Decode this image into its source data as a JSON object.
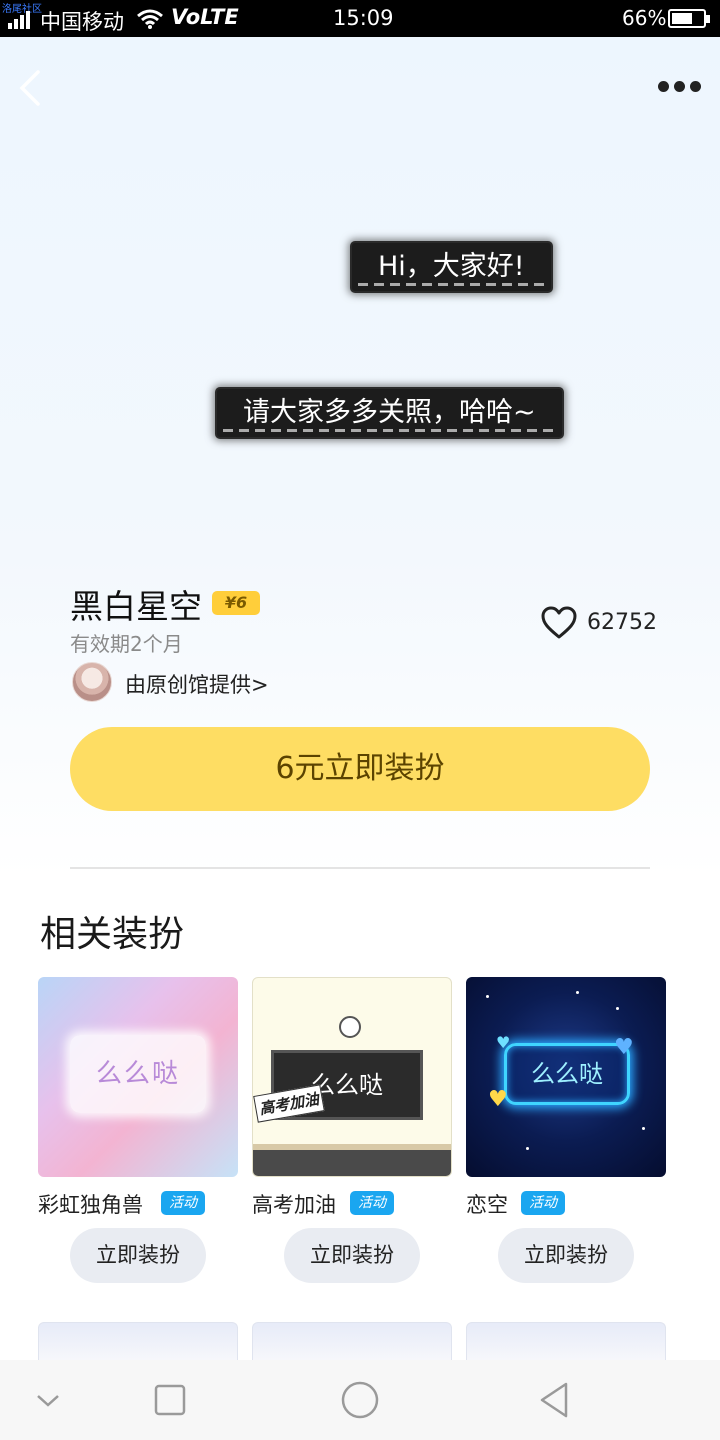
{
  "status_bar": {
    "watermark": "洛尾社区",
    "carrier": "中国移动",
    "network": "VoLTE",
    "time": "15:09",
    "battery": "66%",
    "battery_level": 0.66
  },
  "preview": {
    "bubble_1": "Hi，大家好!",
    "bubble_2": "请大家多多关照，哈哈~"
  },
  "product": {
    "title": "黑白星空",
    "price_badge": "¥6",
    "validity": "有效期2个月",
    "likes": "62752",
    "provider": "由原创馆提供>",
    "buy_button": "6元立即装扮"
  },
  "related": {
    "title": "相关装扮",
    "items": [
      {
        "name": "彩虹独角兽",
        "tag": "活动",
        "thumb_text": "么么哒",
        "button": "立即装扮"
      },
      {
        "name": "高考加油",
        "tag": "活动",
        "thumb_text": "么么哒",
        "thumb_sticker": "高考加油",
        "button": "立即装扮"
      },
      {
        "name": "恋空",
        "tag": "活动",
        "thumb_text": "么么哒",
        "button": "立即装扮"
      }
    ]
  },
  "colors": {
    "accent_yellow": "#fedd63",
    "tag_blue": "#1aa6f0"
  }
}
